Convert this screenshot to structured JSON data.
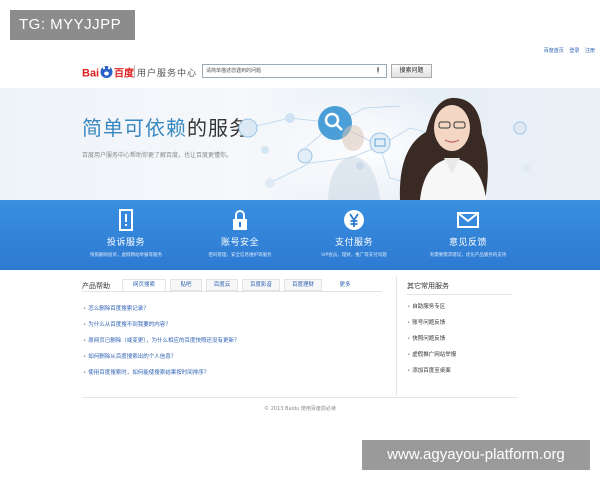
{
  "watermarks": {
    "tg": "TG: MYYJJPP",
    "url": "www.agyayou-platform.org"
  },
  "top_links": [
    "百度首页",
    "登录",
    "注册"
  ],
  "header": {
    "logo_title": "用户服务中心",
    "search_placeholder": "请简单描述您遇到的问题",
    "search_button": "搜索问题"
  },
  "banner": {
    "slogan_part1": "简单可依赖",
    "slogan_part2": "的服务",
    "subtitle": "百度用户服务中心帮助你更了解百度，也让百度更懂你。"
  },
  "features": [
    {
      "title": "投诉服务",
      "desc": "快照删除投诉，虚假网站举报等服务",
      "icon": "alert-icon"
    },
    {
      "title": "账号安全",
      "desc": "密码管理，安全信息维护等服务",
      "icon": "lock-icon"
    },
    {
      "title": "支付服务",
      "desc": "VIP会员，理财，推广等支付问题",
      "icon": "yen-icon"
    },
    {
      "title": "意见反馈",
      "desc": "有需要需求建议，优化产品服务的支持",
      "icon": "mail-icon"
    }
  ],
  "help": {
    "title": "产品帮助",
    "tabs": [
      "网页搜索",
      "贴吧",
      "百度云",
      "百度影音",
      "百度理财",
      "更多"
    ],
    "questions": [
      "怎么删除百度搜索记录？",
      "为什么从百度搜不到我要的内容？",
      "原网页已删除（或变更），为什么相应的百度快照还没有更新？",
      "如何删除从百度搜索出的个人信息？",
      "使用百度搜索时，如何能使搜索结果按时间排序？"
    ]
  },
  "side": {
    "title": "其它常用服务",
    "items": [
      "自助服务专区",
      "账号问题反馈",
      "快照问题反馈",
      "虚假推广网站举报",
      "添加百度至桌面"
    ]
  },
  "footer": {
    "copyright": "© 2013 Baidu 使用百度前必读"
  },
  "colors": {
    "brand_blue": "#2d7ad2",
    "slogan_blue": "#3a88c0",
    "link_blue": "#2b5fb3",
    "baidu_red": "#de2021"
  }
}
